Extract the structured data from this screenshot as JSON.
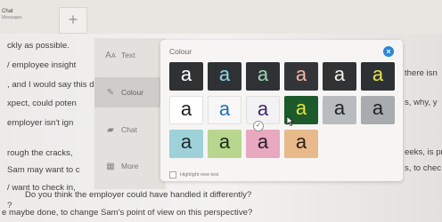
{
  "tab": {
    "title": "Chat",
    "subtitle": "Messages"
  },
  "new_tab_label": "+",
  "document_lines": [
    "ckly as possible.",
    "/ employee insight",
    ", and I would say this does appe",
    "xpect, could poten",
    "employer isn't ign",
    "rough the cracks,",
    "Sam may want to c",
    "/ want to check in,",
    "?",
    "Do you think the employer could have handled it differently?",
    "e maybe done, to change Sam's point of view on this perspective?"
  ],
  "right_fragments": [
    "there isn",
    "s, why, y",
    "eeks, is pr",
    "s, to chec"
  ],
  "menu": {
    "items": [
      {
        "label": "Text",
        "icon": "text-size-icon",
        "glyph": "Aᴀ"
      },
      {
        "label": "Colour",
        "icon": "pen-icon",
        "glyph": "✎"
      },
      {
        "label": "Chat",
        "icon": "chat-bubble-icon",
        "glyph": "▰"
      },
      {
        "label": "More",
        "icon": "grid-icon",
        "glyph": "▦"
      }
    ]
  },
  "colour_panel": {
    "title": "Colour",
    "close_glyph": "×",
    "swatches": [
      {
        "glyph": "a",
        "bg": "#2f3133",
        "fg": "#ffffff"
      },
      {
        "glyph": "a",
        "bg": "#2e3235",
        "fg": "#8fd8e8"
      },
      {
        "glyph": "a",
        "bg": "#2e3235",
        "fg": "#9ed7b4"
      },
      {
        "glyph": "a",
        "bg": "#333538",
        "fg": "#f4b6a8"
      },
      {
        "glyph": "a",
        "bg": "#303234",
        "fg": "#f3f0ea"
      },
      {
        "glyph": "a",
        "bg": "#2e3133",
        "fg": "#e8e54a"
      },
      {
        "glyph": "a",
        "bg": "#ffffff",
        "fg": "#1f1f1f"
      },
      {
        "glyph": "a",
        "bg": "#f7f7f7",
        "fg": "#1f6fb8"
      },
      {
        "glyph": "a",
        "bg": "#f2f1f3",
        "fg": "#3e2a6d"
      },
      {
        "glyph": "a",
        "bg": "#1c5a2b",
        "fg": "#e9e23e"
      },
      {
        "glyph": "a",
        "bg": "#b8bcbe",
        "fg": "#20252a"
      },
      {
        "glyph": "a",
        "bg": "#a8acaf",
        "fg": "#1f2326"
      },
      {
        "glyph": "a",
        "bg": "#9fd1d8",
        "fg": "#1a2c33"
      },
      {
        "glyph": "a",
        "bg": "#b8d68e",
        "fg": "#1c2a16"
      },
      {
        "glyph": "a",
        "bg": "#e8a8c0",
        "fg": "#2a1b24"
      },
      {
        "glyph": "a",
        "bg": "#e8b98a",
        "fg": "#2b1e14"
      }
    ],
    "selected_index": 8,
    "check_glyph": "✓",
    "highlight_label": "Highlight new text"
  },
  "colors": {
    "accent": "#2b87d6"
  }
}
